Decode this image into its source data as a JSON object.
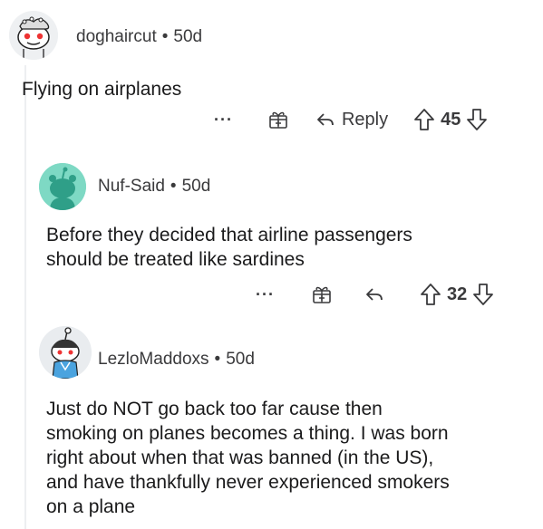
{
  "comments": [
    {
      "username": "doghaircut",
      "separator": "•",
      "age": "50d",
      "text": "Flying on airplanes",
      "more_icon": "more-icon",
      "reply_label": "Reply",
      "upvotes": "45"
    },
    {
      "username": "Nuf-Said",
      "separator": "•",
      "age": "50d",
      "text_lines": [
        "Before they decided that airline passengers",
        "should be treated like sardines"
      ],
      "upvotes": "32"
    },
    {
      "username": "LezloMaddoxs",
      "separator": "•",
      "age": "50d",
      "text_lines": [
        "Just do NOT go back too far cause then",
        "smoking on planes becomes a thing. I was born",
        "right about when that was banned (in the US),",
        "and have thankfully never experienced smokers",
        "on a plane"
      ]
    }
  ],
  "colors": {
    "avatar_green_bg": "#7ed9c4",
    "avatar_gray_bg": "#e9ecef",
    "text": "#1a1a1b",
    "meta": "#3a3a3c"
  }
}
